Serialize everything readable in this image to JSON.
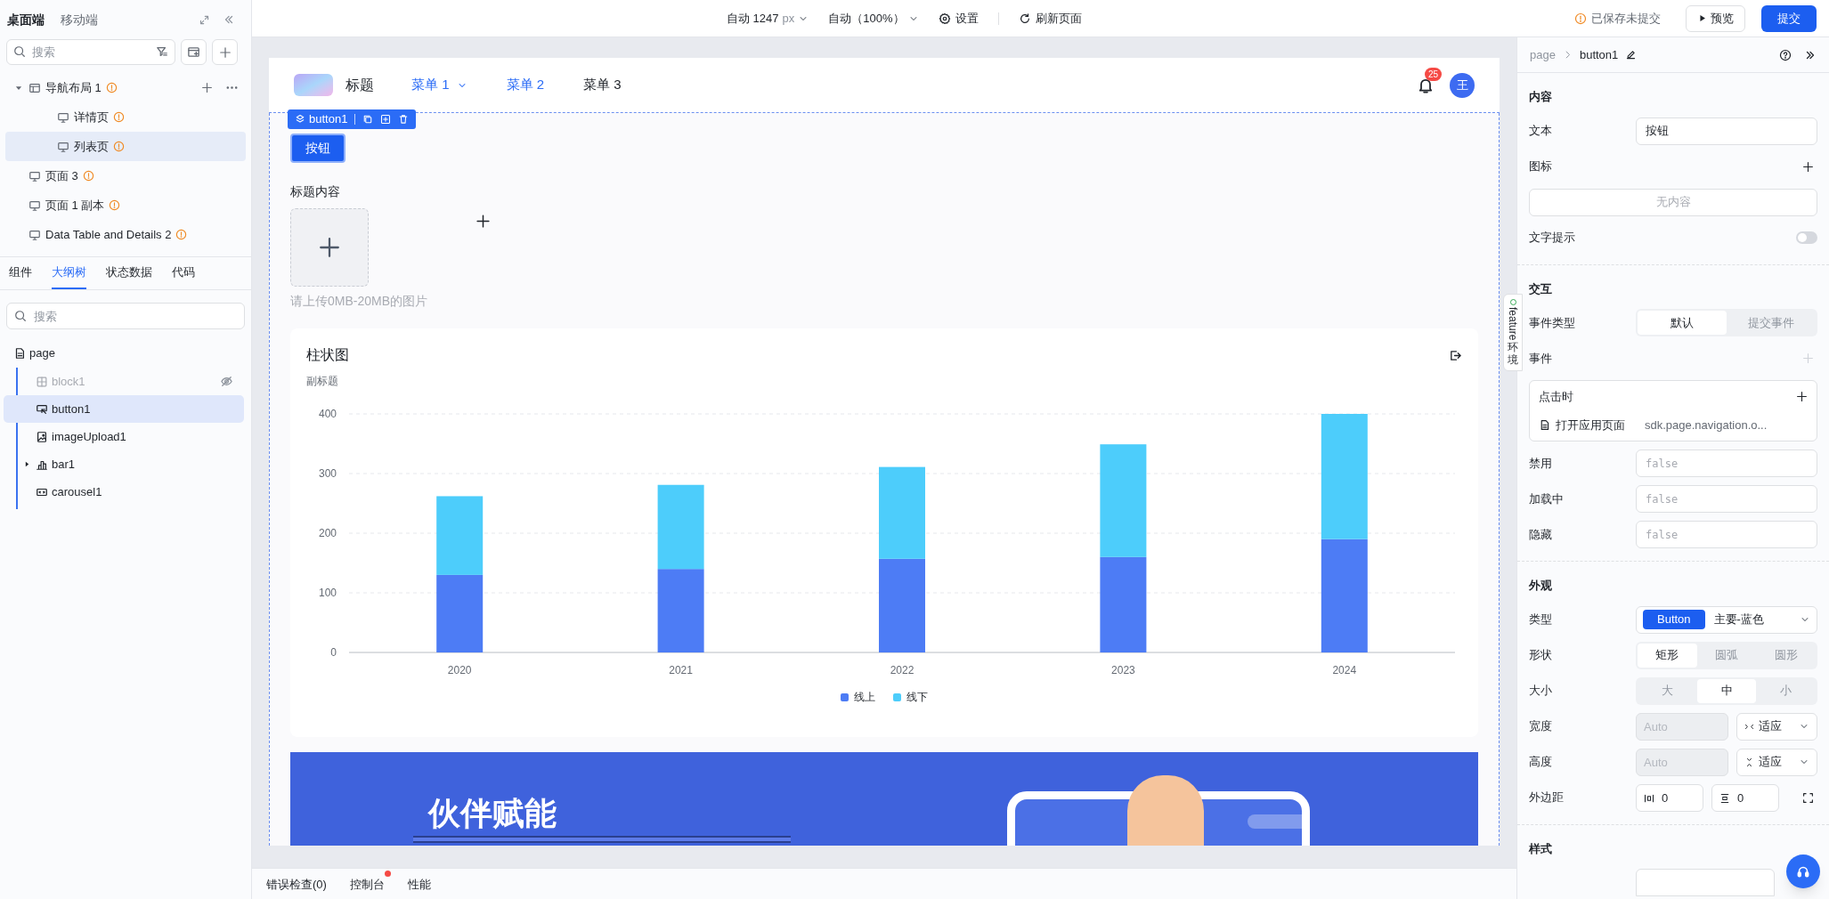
{
  "sidebar": {
    "tabs": [
      {
        "label": "桌面端",
        "selected": true
      },
      {
        "label": "移动端",
        "selected": false
      }
    ],
    "search": {
      "placeholder": "搜索"
    },
    "pages": [
      {
        "label": "导航布局 1",
        "kind": "layout",
        "warning": true,
        "selected": false,
        "expanded": true,
        "children": [
          {
            "label": "详情页",
            "kind": "page",
            "warning": true,
            "selected": false
          },
          {
            "label": "列表页",
            "kind": "page",
            "warning": true,
            "selected": true
          }
        ]
      },
      {
        "label": "页面 3",
        "kind": "page",
        "warning": true,
        "selected": false
      },
      {
        "label": "页面 1 副本",
        "kind": "page",
        "warning": true,
        "selected": false
      },
      {
        "label": "Data Table and Details 2",
        "kind": "page",
        "warning": true,
        "selected": false
      }
    ],
    "panel_tabs": [
      {
        "label": "组件",
        "selected": false
      },
      {
        "label": "大纲树",
        "selected": true
      },
      {
        "label": "状态数据",
        "selected": false
      },
      {
        "label": "代码",
        "selected": false
      }
    ],
    "outline_search": {
      "placeholder": "搜索"
    },
    "outline": [
      {
        "label": "page",
        "kind": "page",
        "selected": false,
        "children": [
          {
            "label": "block1",
            "kind": "block",
            "hidden": true,
            "selected": false
          },
          {
            "label": "button1",
            "kind": "button",
            "hidden": false,
            "selected": true
          },
          {
            "label": "imageUpload1",
            "kind": "image",
            "hidden": false,
            "selected": false
          },
          {
            "label": "bar1",
            "kind": "chart",
            "hidden": false,
            "selected": false,
            "expanded": false
          },
          {
            "label": "carousel1",
            "kind": "carousel",
            "hidden": false,
            "selected": false
          }
        ]
      }
    ]
  },
  "toolbar": {
    "width_mode": "自动 1247",
    "width_unit": "px",
    "zoom": "自动（100%）",
    "settings": "设置",
    "refresh": "刷新页面",
    "save_status": "已保存未提交",
    "preview": "预览",
    "submit": "提交"
  },
  "canvas": {
    "nav": {
      "title": "标题",
      "menus": [
        {
          "label": "菜单 1",
          "selected": true,
          "kind": "dropdown"
        },
        {
          "label": "菜单 2",
          "selected": true,
          "kind": "link"
        },
        {
          "label": "菜单 3",
          "selected": false,
          "kind": "link"
        }
      ],
      "notification_count": "25",
      "avatar": "王"
    },
    "selection": {
      "label": "button1"
    },
    "button": {
      "label": "按钮"
    },
    "upload": {
      "label": "标题内容",
      "hint": "请上传0MB-20MB的图片"
    },
    "chart": {
      "title": "柱状图",
      "subtitle": "副标题",
      "chart_data": {
        "type": "bar",
        "stacked": true,
        "grid": true,
        "categories": [
          "2020",
          "2021",
          "2022",
          "2023",
          "2024"
        ],
        "yticks": [
          0,
          100,
          200,
          300,
          400
        ],
        "ylim": [
          0,
          400
        ],
        "series": [
          {
            "name": "线上",
            "color": "#4d7cf5",
            "values": [
              130,
              140,
              157,
              160,
              190
            ]
          },
          {
            "name": "线下",
            "color": "#4dcdfb",
            "values": [
              132,
              141,
              154,
              189,
              210
            ]
          }
        ]
      }
    },
    "banner": {
      "title": "伙伴赋能"
    }
  },
  "properties": {
    "breadcrumb": [
      "page",
      "button1"
    ],
    "sections": [
      {
        "title": "内容",
        "rows": [
          {
            "kind": "input",
            "label": "文本",
            "value": "按钮"
          },
          {
            "kind": "add",
            "label": "图标",
            "disabled": false
          },
          {
            "kind": "empty",
            "text": "无内容"
          },
          {
            "kind": "toggle",
            "label": "文字提示",
            "on": false
          }
        ]
      },
      {
        "title": "交互",
        "rows": [
          {
            "kind": "segmented",
            "label": "事件类型",
            "options": [
              {
                "label": "默认",
                "selected": true
              },
              {
                "label": "提交事件",
                "selected": false
              }
            ]
          },
          {
            "kind": "add",
            "label": "事件",
            "disabled": true
          },
          {
            "kind": "event",
            "trigger": "点击时",
            "action": "打开应用页面",
            "target": "sdk.page.navigation.o..."
          },
          {
            "kind": "code",
            "label": "禁用",
            "placeholder": "false"
          },
          {
            "kind": "code",
            "label": "加载中",
            "placeholder": "false"
          },
          {
            "kind": "code",
            "label": "隐藏",
            "placeholder": "false"
          }
        ]
      },
      {
        "title": "外观",
        "rows": [
          {
            "kind": "type",
            "label": "类型",
            "tag": "Button",
            "value": "主要-蓝色"
          },
          {
            "kind": "segmented",
            "label": "形状",
            "options": [
              {
                "label": "矩形",
                "selected": true
              },
              {
                "label": "圆弧",
                "selected": false
              },
              {
                "label": "圆形",
                "selected": false
              }
            ]
          },
          {
            "kind": "segmented",
            "label": "大小",
            "options": [
              {
                "label": "大",
                "selected": false
              },
              {
                "label": "中",
                "selected": true
              },
              {
                "label": "小",
                "selected": false
              }
            ]
          },
          {
            "kind": "size",
            "label": "宽度",
            "placeholder": "Auto",
            "mode": "适应"
          },
          {
            "kind": "size",
            "label": "高度",
            "placeholder": "Auto",
            "mode": "适应"
          },
          {
            "kind": "margin",
            "label": "外边距",
            "values": [
              "0",
              "0"
            ]
          }
        ]
      },
      {
        "title": "样式"
      }
    ]
  },
  "feature_tab": {
    "label": "feature",
    "suffix": "环境"
  },
  "bottom_bar": {
    "tabs": [
      {
        "label": "错误检查(0)",
        "alert": false
      },
      {
        "label": "控制台",
        "alert": true
      },
      {
        "label": "性能",
        "alert": false
      }
    ]
  }
}
